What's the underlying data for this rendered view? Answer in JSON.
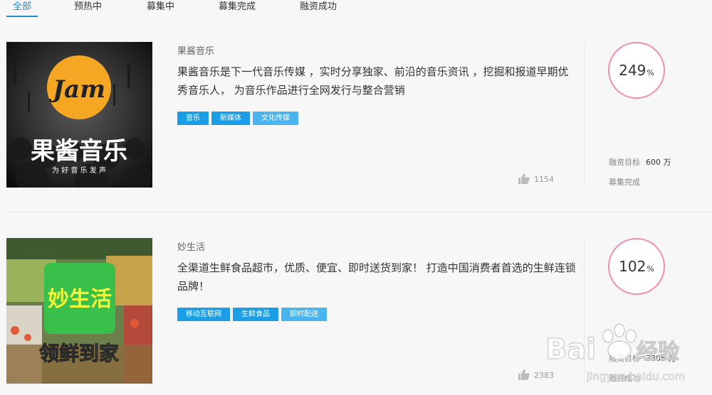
{
  "tabs": [
    {
      "label": "全部",
      "active": true
    },
    {
      "label": "预热中",
      "active": false
    },
    {
      "label": "募集中",
      "active": false
    },
    {
      "label": "募集完成",
      "active": false
    },
    {
      "label": "融资成功",
      "active": false
    }
  ],
  "projects": [
    {
      "name": "果酱音乐",
      "description": "果酱音乐是下一代音乐传媒 ，实时分享独家、前沿的音乐资讯 ，挖掘和报道早期优秀音乐人， 为音乐作品进行全网发行与整合营销",
      "tags": [
        "音乐",
        "新媒体",
        "文化传媒"
      ],
      "likes": "1154",
      "progress_number": "249",
      "progress_unit": "%",
      "goal_label": "融资目标",
      "goal_value": "600 万",
      "status": "募集完成",
      "image": {
        "logo_text": "Jam",
        "title_text": "果酱音乐",
        "slogan": "为 好 音 乐 发 声"
      }
    },
    {
      "name": "妙生活",
      "description": "全渠道生鲜食品超市，优质、便宜、即时送货到家！ 打造中国消费者首选的生鲜连锁品牌！",
      "tags": [
        "移动互联网",
        "生鲜食品",
        "即时配送"
      ],
      "likes": "2383",
      "progress_number": "102",
      "progress_unit": "%",
      "goal_label": "融资目标",
      "goal_value": "3305 万",
      "status": "融资成功",
      "image": {
        "logo_text": "妙生活",
        "slogan": "领鲜到家"
      }
    }
  ],
  "watermark": {
    "brand": "Bai",
    "brand_cn": "经验",
    "url": "jingyan.baidu.com"
  },
  "colors": {
    "accent": "#1e8ad6",
    "tag": "#1c9ee6",
    "tag_light": "#49b4ee",
    "ring": "#f08bb2"
  }
}
